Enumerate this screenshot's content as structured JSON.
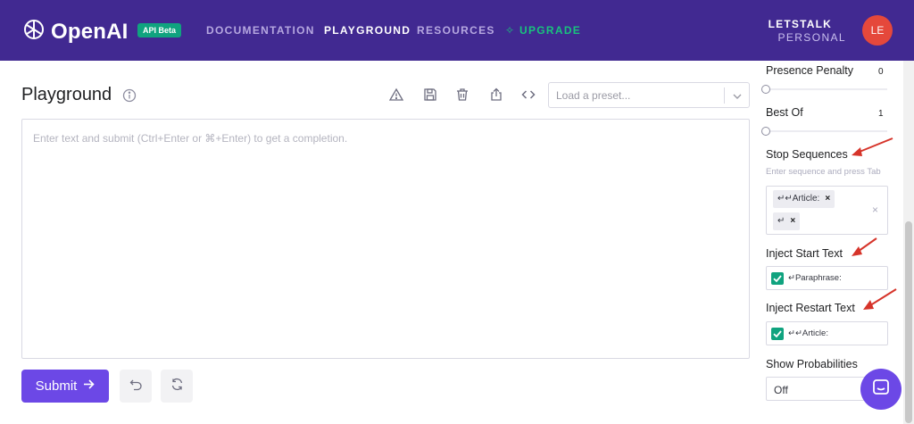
{
  "header": {
    "brand": "OpenAI",
    "badge": "API Beta",
    "nav": [
      {
        "label": "DOCUMENTATION"
      },
      {
        "label": "PLAYGROUND"
      },
      {
        "label": "RESOURCES"
      },
      {
        "label": "UPGRADE"
      }
    ],
    "user": {
      "name": "LETSTALK",
      "org": "PERSONAL",
      "initials": "LE"
    }
  },
  "main": {
    "title": "Playground",
    "preset_placeholder": "Load a preset...",
    "editor_placeholder": "Enter text and submit (Ctrl+Enter or ⌘+Enter) to get a completion.",
    "submit_label": "Submit"
  },
  "settings": {
    "presence_penalty": {
      "label": "Presence Penalty",
      "value": "0"
    },
    "best_of": {
      "label": "Best Of",
      "value": "1"
    },
    "stop_sequences": {
      "label": "Stop Sequences",
      "hint": "Enter sequence and press Tab",
      "tags": [
        "↵↵Article:",
        "↵"
      ]
    },
    "inject_start": {
      "label": "Inject Start Text",
      "value": "↵Paraphrase:"
    },
    "inject_restart": {
      "label": "Inject Restart Text",
      "value": "↵↵Article:"
    },
    "show_probabilities": {
      "label": "Show Probabilities",
      "value": "Off"
    }
  },
  "colors": {
    "header_bg": "#412991",
    "accent": "#6c48e6",
    "brand_green": "#10a37f",
    "annotation_arrow": "#d6342a"
  },
  "icons": [
    "openai-logo-icon",
    "info-icon",
    "warning-icon",
    "save-icon",
    "trash-icon",
    "share-icon",
    "code-icon",
    "chevron-down-icon",
    "arrow-right-icon",
    "undo-icon",
    "regenerate-icon",
    "chat-icon"
  ]
}
